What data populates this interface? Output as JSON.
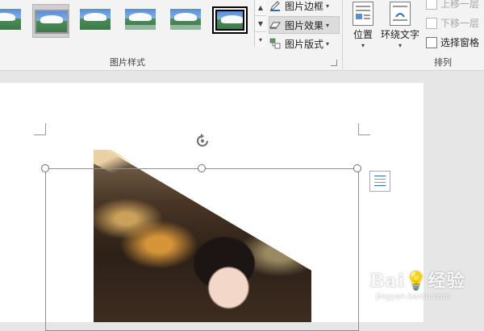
{
  "ribbon": {
    "picture_styles_label": "图片样式",
    "arrange_label": "排列",
    "picture_border": "图片边框",
    "picture_effects": "图片效果",
    "picture_layout": "图片版式",
    "position": "位置",
    "wrap_text": "环绕文字",
    "bring_forward": "上移一层",
    "send_backward": "下移一层",
    "selection_pane": "选择窗格",
    "caret": "▾"
  },
  "watermark": {
    "logo": "Bai💡经验",
    "url": "jingyan.baidu.com"
  },
  "colors": {
    "ribbon_bg": "#f3f3f3",
    "canvas_bg": "#e6e6e6",
    "accent": "#2f6eb5"
  }
}
